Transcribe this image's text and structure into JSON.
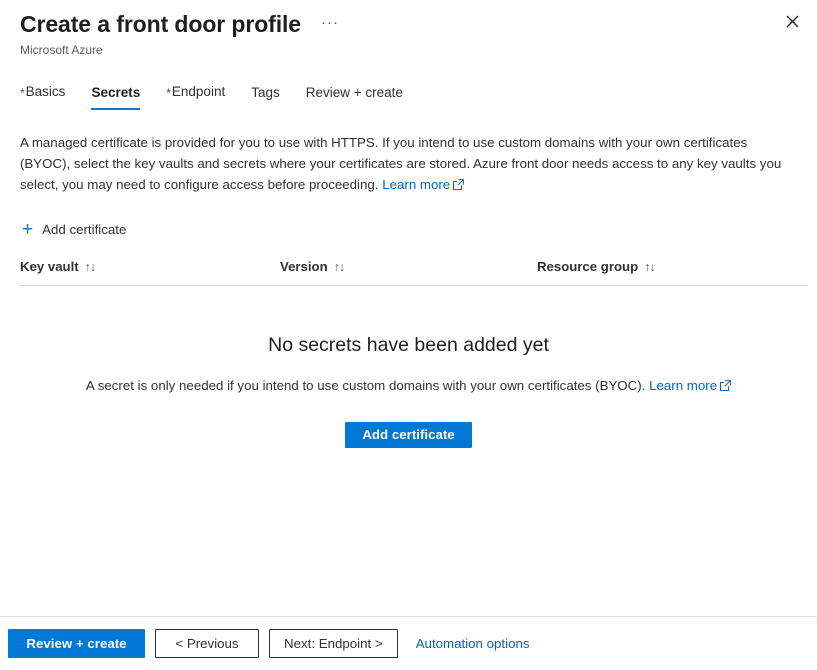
{
  "header": {
    "title": "Create a front door profile",
    "subtitle": "Microsoft Azure",
    "ellipsis_label": "···",
    "close_label": "Close"
  },
  "tabs": [
    {
      "label": "Basics",
      "required": true,
      "active": false
    },
    {
      "label": "Secrets",
      "required": false,
      "active": true
    },
    {
      "label": "Endpoint",
      "required": true,
      "active": false
    },
    {
      "label": "Tags",
      "required": false,
      "active": false
    },
    {
      "label": "Review + create",
      "required": false,
      "active": false
    }
  ],
  "description": {
    "text": "A managed certificate is provided for you to use with HTTPS. If you intend to use custom domains with your own certificates (BYOC), select the key vaults and secrets where your certificates are stored. Azure front door needs access to any key vaults you select, you may need to configure access before proceeding.",
    "link_label": "Learn more"
  },
  "commandbar": {
    "add_certificate_label": "Add certificate",
    "plus_glyph": "+"
  },
  "table": {
    "columns": [
      {
        "label": "Key vault",
        "sort_glyph": "↑↓"
      },
      {
        "label": "Version",
        "sort_glyph": "↑↓"
      },
      {
        "label": "Resource group",
        "sort_glyph": "↑↓"
      }
    ],
    "rows": []
  },
  "empty_state": {
    "title": "No secrets have been added yet",
    "subtitle": "A secret is only needed if you intend to use custom domains with your own certificates (BYOC).",
    "link_label": "Learn more",
    "button_label": "Add certificate"
  },
  "footer": {
    "review_create_label": "Review + create",
    "previous_label": "< Previous",
    "next_label": "Next: Endpoint >",
    "automation_label": "Automation options"
  },
  "colors": {
    "accent": "#0078d4",
    "link": "#0066bf",
    "required_asterisk": "#a4262c",
    "text": "#323130",
    "subtle_text": "#605e5c",
    "border": "#d6d6d6"
  }
}
